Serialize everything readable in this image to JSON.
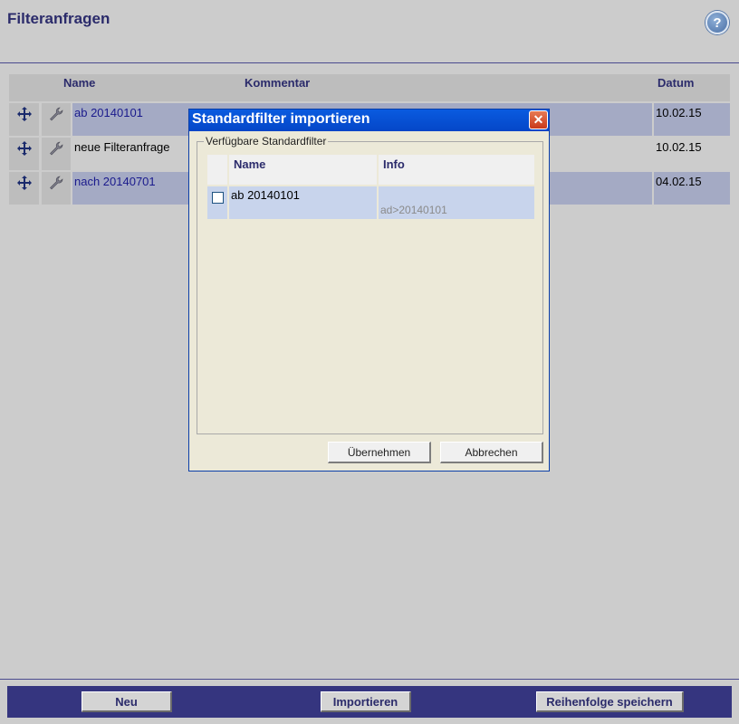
{
  "page": {
    "title": "Filteranfragen",
    "help_label": "?"
  },
  "list": {
    "columns": {
      "name": "Name",
      "comment": "Kommentar",
      "date": "Datum"
    },
    "rows": [
      {
        "name": "ab 20140101",
        "date": "10.02.15",
        "highlighted": true
      },
      {
        "name": "neue Filteranfrage",
        "date": "10.02.15",
        "highlighted": false
      },
      {
        "name": "nach 20140701",
        "date": "04.02.15",
        "highlighted": true
      }
    ]
  },
  "dialog": {
    "title": "Standardfilter importieren",
    "close_label": "✕",
    "fieldset_legend": "Verfügbare Standardfilter",
    "columns": {
      "name": "Name",
      "info": "Info"
    },
    "rows": [
      {
        "name": "ab 20140101",
        "info": "ad>20140101",
        "checked": false
      }
    ],
    "apply_label": "Übernehmen",
    "cancel_label": "Abbrechen"
  },
  "footer": {
    "new_label": "Neu",
    "import_label": "Importieren",
    "save_order_label": "Reihenfolge speichern"
  },
  "colors": {
    "accent": "#35357f",
    "row_highlight": "#a4aac4",
    "dialog_titlebar": "#0446c8"
  }
}
